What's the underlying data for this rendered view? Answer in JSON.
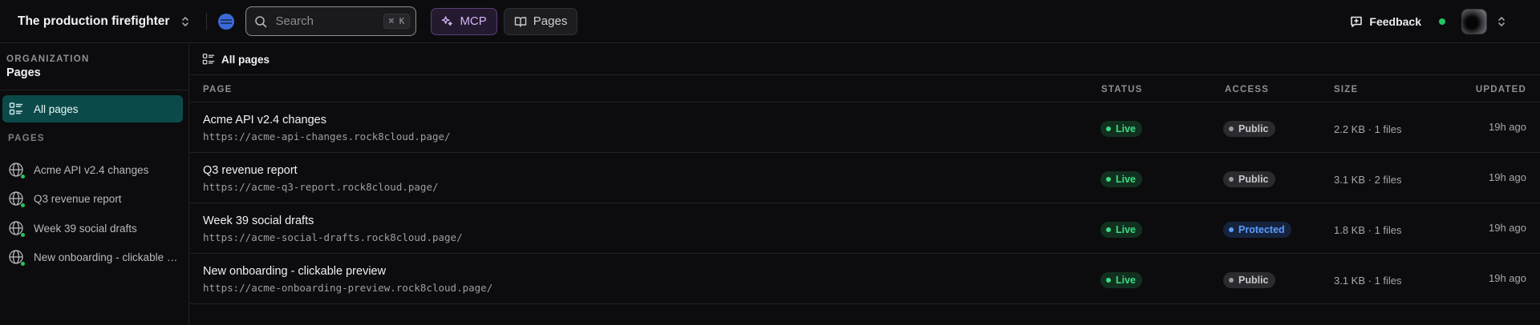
{
  "topbar": {
    "workspace_name": "The production firefighter",
    "search_placeholder": "Search",
    "search_shortcut": "⌘ K",
    "mcp_label": "MCP",
    "pages_label": "Pages",
    "feedback_label": "Feedback",
    "accent": "#3b6ad8",
    "status_color": "#22c55e"
  },
  "sidebar": {
    "org_label": "ORGANIZATION",
    "org_title": "Pages",
    "active_item": "All pages",
    "section_label": "PAGES",
    "items": [
      {
        "label": "Acme API v2.4 changes",
        "icon": "globe-icon"
      },
      {
        "label": "Q3 revenue report",
        "icon": "globe-icon"
      },
      {
        "label": "Week 39 social drafts",
        "icon": "globe-icon"
      },
      {
        "label": "New onboarding - clickable preview",
        "icon": "globe-icon"
      }
    ]
  },
  "main": {
    "header_title": "All pages",
    "columns": {
      "page": "PAGE",
      "status": "STATUS",
      "access": "ACCESS",
      "size": "SIZE",
      "updated": "UPDATED"
    },
    "rows": [
      {
        "title": "Acme API v2.4 changes",
        "url": "https://acme-api-changes.rock8cloud.page/",
        "status": "Live",
        "access": "Public",
        "size": "2.2 KB · 1 files",
        "updated": "19h ago"
      },
      {
        "title": "Q3 revenue report",
        "url": "https://acme-q3-report.rock8cloud.page/",
        "status": "Live",
        "access": "Public",
        "size": "3.1 KB · 2 files",
        "updated": "19h ago"
      },
      {
        "title": "Week 39 social drafts",
        "url": "https://acme-social-drafts.rock8cloud.page/",
        "status": "Live",
        "access": "Protected",
        "size": "1.8 KB · 1 files",
        "updated": "19h ago"
      },
      {
        "title": "New onboarding - clickable preview",
        "url": "https://acme-onboarding-preview.rock8cloud.page/",
        "status": "Live",
        "access": "Public",
        "size": "3.1 KB · 1 files",
        "updated": "19h ago"
      }
    ]
  }
}
